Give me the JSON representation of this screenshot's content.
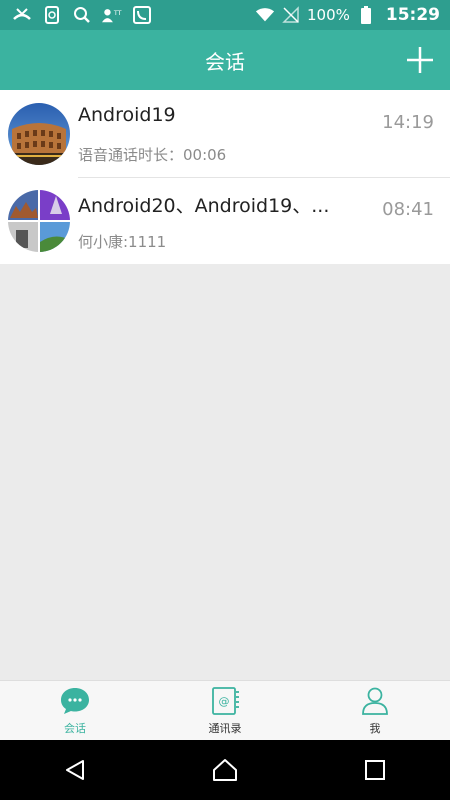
{
  "status_bar": {
    "battery_text": "100%",
    "time": "15:29",
    "icons": [
      "missed-call-icon",
      "phone-sync-icon",
      "search-icon",
      "contacts-tty-icon",
      "hd-call-icon",
      "wifi-icon",
      "no-signal-icon",
      "battery-icon"
    ]
  },
  "header": {
    "title": "会话",
    "add_icon": "plus-icon"
  },
  "conversations": [
    {
      "name": "Android19",
      "time": "14:19",
      "preview": "语音通话时长：00:06",
      "avatar": "colosseum-photo"
    },
    {
      "name": "Android20、Android19、...",
      "time": "08:41",
      "preview": "何小康:1111",
      "avatar": "group-collage"
    }
  ],
  "tabs": [
    {
      "label": "会话",
      "icon": "chat-bubble-icon",
      "active": true
    },
    {
      "label": "通讯录",
      "icon": "address-book-icon",
      "active": false
    },
    {
      "label": "我",
      "icon": "person-icon",
      "active": false
    }
  ],
  "colors": {
    "status_bar": "#2e9e8f",
    "header": "#3bb3a0",
    "accent": "#3bb3a0",
    "background": "#ebebeb"
  }
}
